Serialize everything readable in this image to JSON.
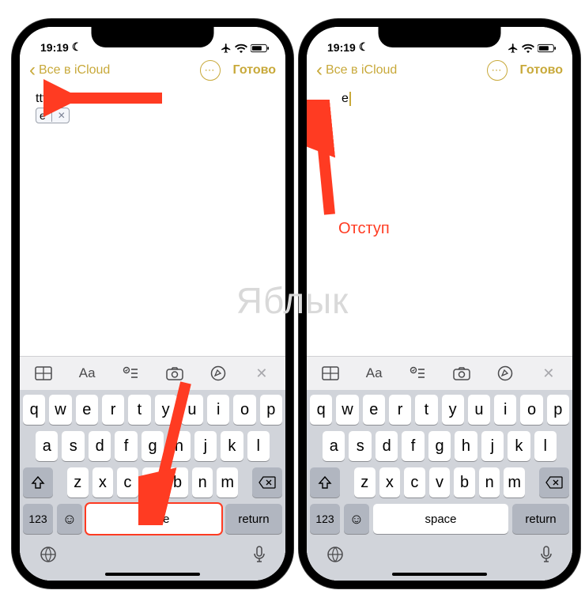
{
  "status": {
    "time": "19:19",
    "moon": "☾"
  },
  "nav": {
    "back": "Все в iCloud",
    "done": "Готово",
    "more": "⋯"
  },
  "note": {
    "left_text": "ttt",
    "suggestion_text": "e",
    "right_text": "e"
  },
  "annotation": {
    "label": "Отступ"
  },
  "format_bar": {
    "close": "✕",
    "aa": "Aa"
  },
  "keyboard": {
    "row1": [
      "q",
      "w",
      "e",
      "r",
      "t",
      "y",
      "u",
      "i",
      "o",
      "p"
    ],
    "row2": [
      "a",
      "s",
      "d",
      "f",
      "g",
      "h",
      "j",
      "k",
      "l"
    ],
    "row3": [
      "z",
      "x",
      "c",
      "v",
      "b",
      "n",
      "m"
    ],
    "num": "123",
    "emoji": "☺",
    "space": "space",
    "return": "return"
  }
}
